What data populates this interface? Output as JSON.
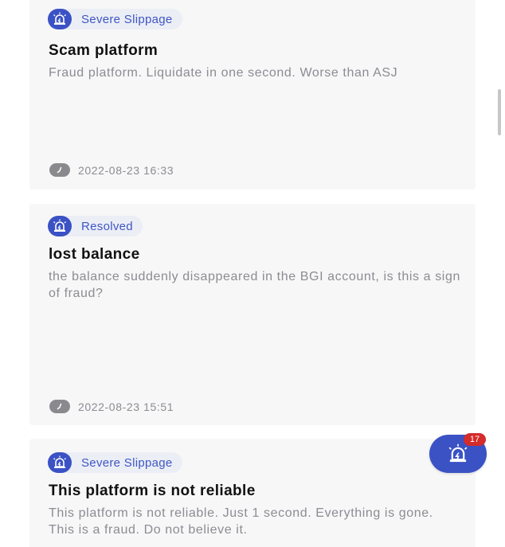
{
  "posts": [
    {
      "status": "Severe Slippage",
      "title": "Scam platform",
      "body": "Fraud platform. Liquidate in one second. Worse than ASJ",
      "timestamp": "2022-08-23 16:33"
    },
    {
      "status": "Resolved",
      "title": "lost balance",
      "body": "the balance suddenly disappeared in the BGI account, is this a sign of fraud?",
      "timestamp": "2022-08-23 15:51"
    },
    {
      "status": "Severe Slippage",
      "title": "This platform is not reliable",
      "body": "This platform is not reliable. Just 1 second. Everything is gone. This is a fraud. Do not believe it."
    }
  ],
  "fab": {
    "count": "17"
  },
  "colors": {
    "accent": "#3a52c4",
    "badge_bg": "#eceef6",
    "card_bg": "#f7f7f8",
    "muted_text": "#8c8c92",
    "notification": "#d42b2b"
  },
  "icons": {
    "status": "alarm-light-icon",
    "time": "clock-icon"
  }
}
